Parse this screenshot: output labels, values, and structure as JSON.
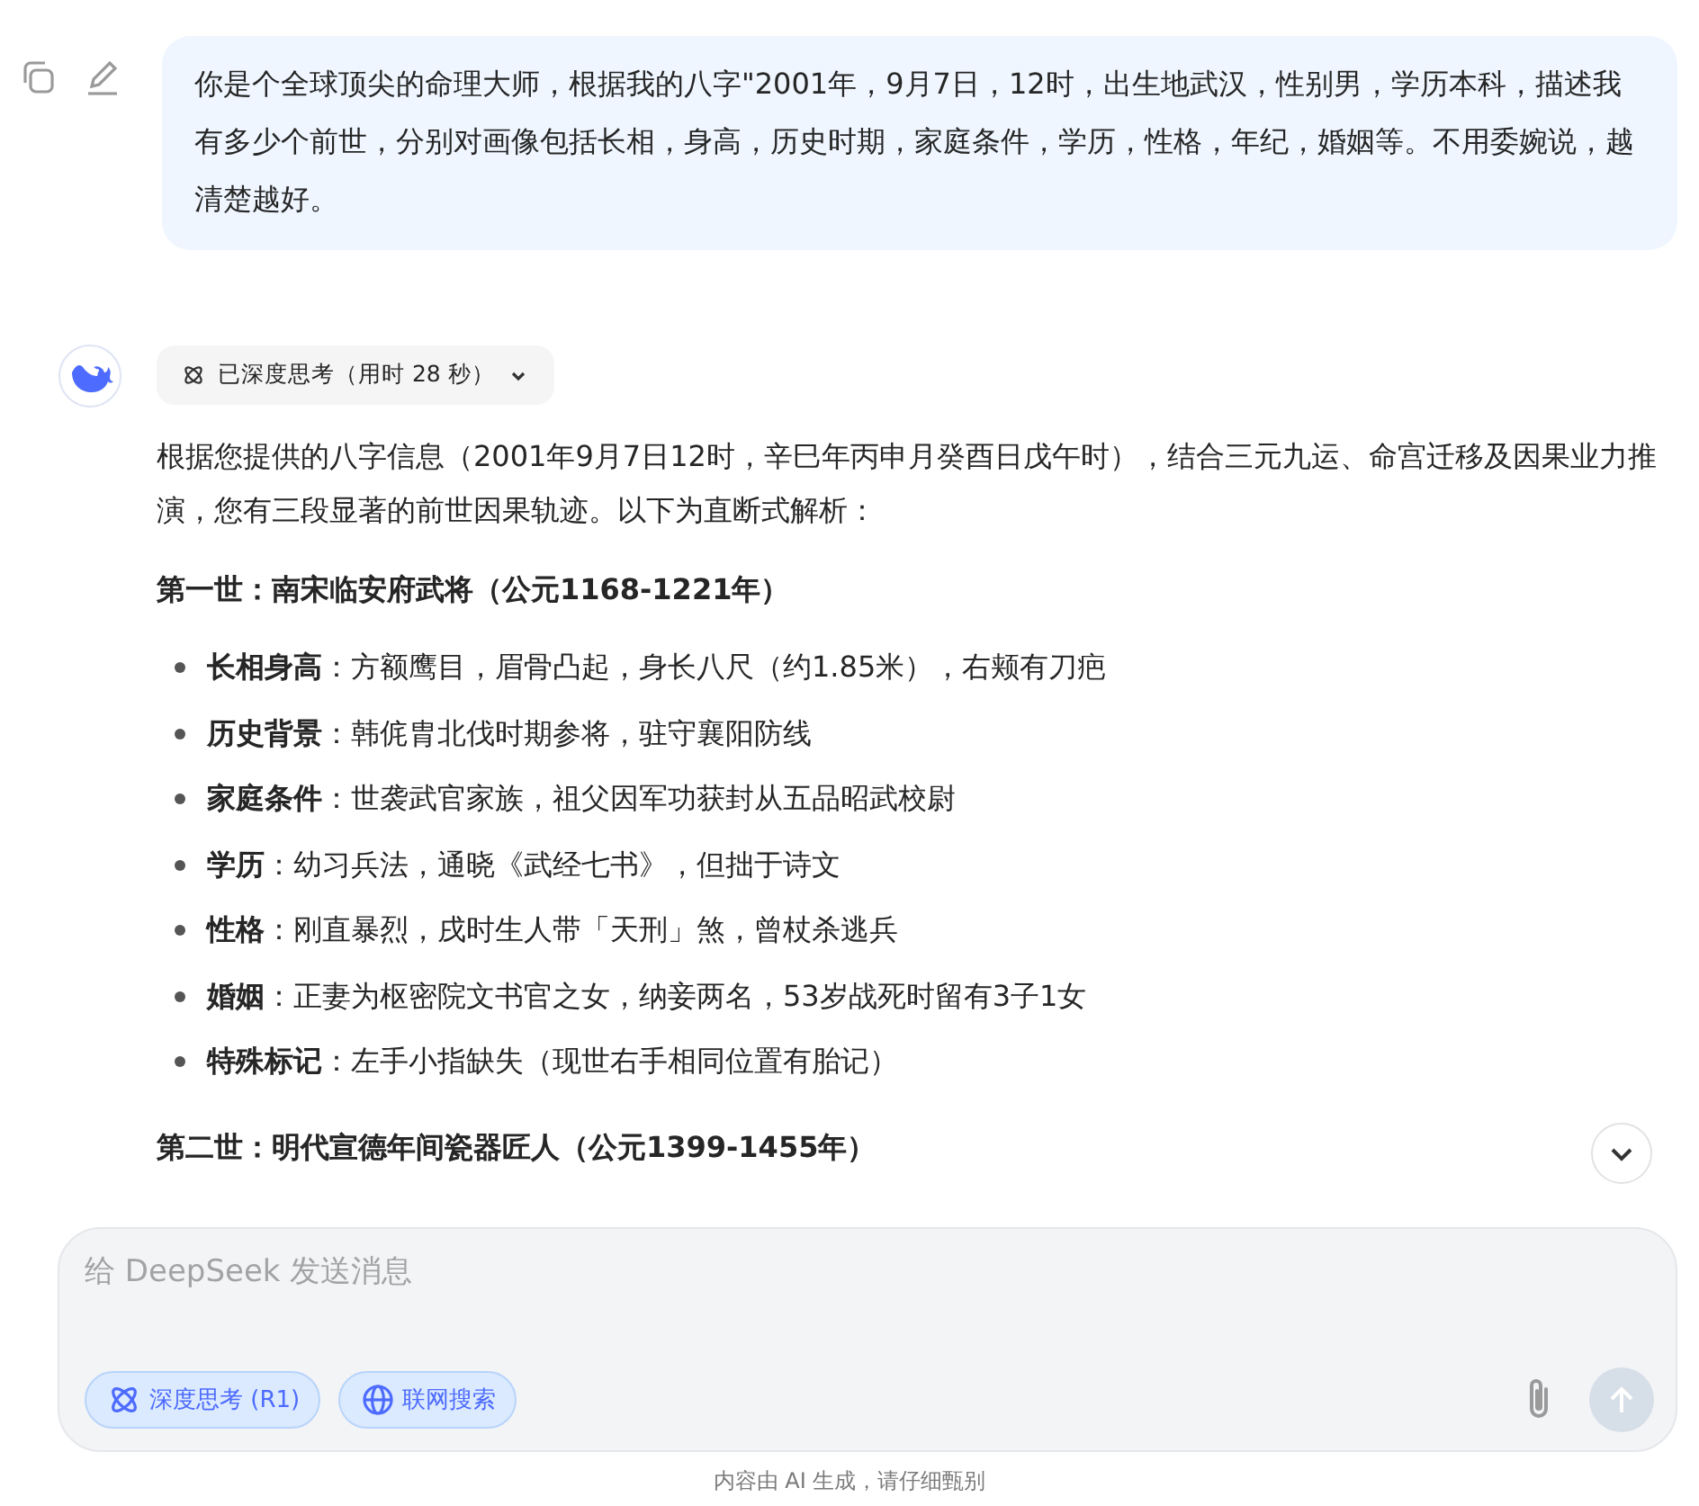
{
  "user_message": {
    "text": "你是个全球顶尖的命理大师，根据我的八字\"2001年，9月7日，12时，出生地武汉，性别男，学历本科，描述我有多少个前世，分别对画像包括长相，身高，历史时期，家庭条件，学历，性格，年纪，婚姻等。不用委婉说，越清楚越好。"
  },
  "assistant": {
    "thinking": {
      "label": "已深度思考（用时 28 秒）",
      "expanded": false
    },
    "blocks": [
      {
        "kind": "paragraph",
        "text": "根据您提供的八字信息（2001年9月7日12时，辛巳年丙申月癸酉日戊午时），结合三元九运、命宫迁移及因果业力推演，您有三段显著的前世因果轨迹。以下为直断式解析："
      },
      {
        "kind": "heading",
        "text": "第一世：南宋临安府武将（公元1168-1221年）"
      },
      {
        "kind": "list",
        "items": [
          "**长相身高**：方额鹰目，眉骨凸起，身长八尺（约1.85米），右颊有刀疤",
          "**历史背景**：韩侂胄北伐时期参将，驻守襄阳防线",
          "**家庭条件**：世袭武官家族，祖父因军功获封从五品昭武校尉",
          "**学历**：幼习兵法，通晓《武经七书》，但拙于诗文",
          "**性格**：刚直暴烈，戌时生人带「天刑」煞，曾杖杀逃兵",
          "**婚姻**：正妻为枢密院文书官之女，纳妾两名，53岁战死时留有3子1女",
          "**特殊标记**：左手小指缺失（现世右手相同位置有胎记）"
        ]
      },
      {
        "kind": "heading",
        "text": "第二世：明代宣德年间瓷器匠人（公元1399-1455年）"
      }
    ]
  },
  "composer": {
    "placeholder": "给 DeepSeek 发送消息",
    "toggles": [
      {
        "kind": "deepthink",
        "label": "深度思考 (R1)",
        "on": true
      },
      {
        "kind": "search",
        "label": "联网搜索",
        "on": true
      }
    ],
    "send_disabled": true
  },
  "footer": "内容由 AI 生成，请仔细甄别"
}
